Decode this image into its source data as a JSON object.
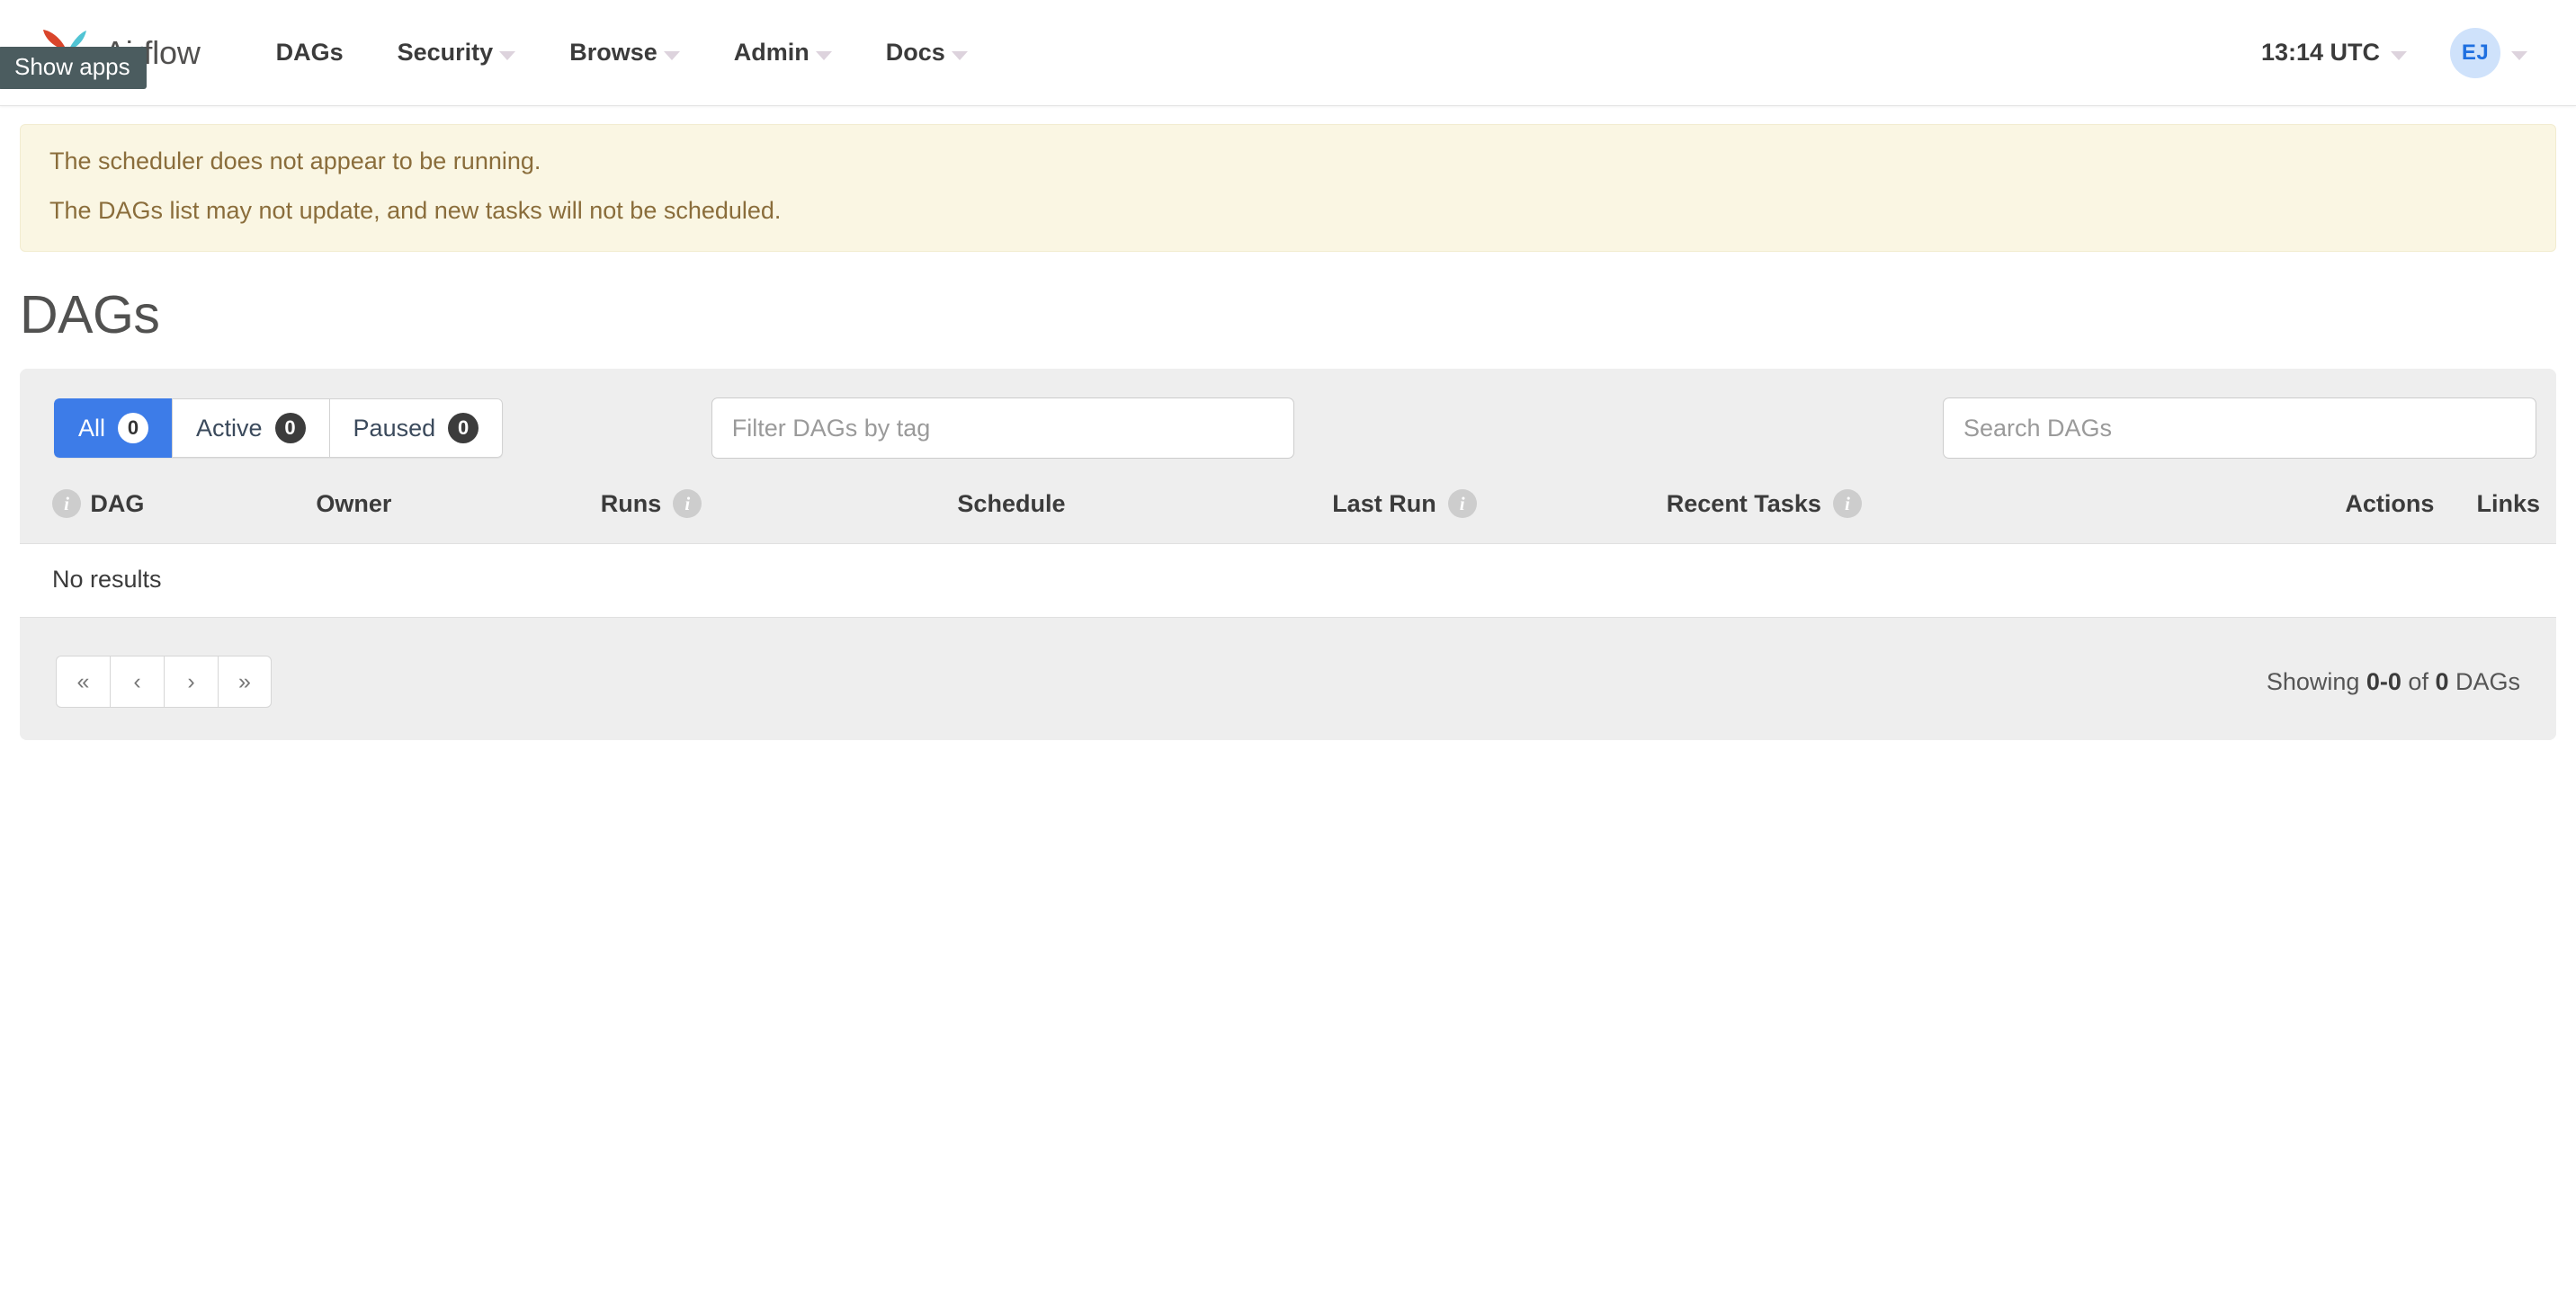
{
  "navbar": {
    "brand_name": "Airflow",
    "logo_icon": "airflow-pinwheel-logo",
    "tooltip": "Show apps",
    "items": [
      {
        "label": "DAGs",
        "has_caret": false
      },
      {
        "label": "Security",
        "has_caret": true
      },
      {
        "label": "Browse",
        "has_caret": true
      },
      {
        "label": "Admin",
        "has_caret": true
      },
      {
        "label": "Docs",
        "has_caret": true
      }
    ],
    "time": "13:14 UTC",
    "avatar_initials": "EJ"
  },
  "alert": {
    "line1": "The scheduler does not appear to be running.",
    "line2": "The DAGs list may not update, and new tasks will not be scheduled."
  },
  "page": {
    "title": "DAGs"
  },
  "toolbar": {
    "tabs": [
      {
        "label": "All",
        "count": "0",
        "active": true
      },
      {
        "label": "Active",
        "count": "0",
        "active": false
      },
      {
        "label": "Paused",
        "count": "0",
        "active": false
      }
    ],
    "filter_tag": {
      "value": "",
      "placeholder": "Filter DAGs by tag"
    },
    "search_dags": {
      "value": "",
      "placeholder": "Search DAGs"
    }
  },
  "table": {
    "columns": [
      {
        "label": "",
        "info": true,
        "align": "left"
      },
      {
        "label": "DAG",
        "info": false,
        "align": "left"
      },
      {
        "label": "Owner",
        "info": false,
        "align": "left"
      },
      {
        "label": "Runs",
        "info": true,
        "align": "left"
      },
      {
        "label": "Schedule",
        "info": false,
        "align": "left"
      },
      {
        "label": "Last Run",
        "info": true,
        "align": "left"
      },
      {
        "label": "Recent Tasks",
        "info": true,
        "align": "left"
      },
      {
        "label": "Actions",
        "info": false,
        "align": "right"
      },
      {
        "label": "Links",
        "info": false,
        "align": "right"
      }
    ],
    "empty_text": "No results",
    "rows": []
  },
  "pagination": {
    "buttons": [
      {
        "label": "«",
        "name": "first"
      },
      {
        "label": "‹",
        "name": "prev"
      },
      {
        "label": "›",
        "name": "next"
      },
      {
        "label": "»",
        "name": "last"
      }
    ],
    "showing_prefix": "Showing ",
    "showing_range": "0-0",
    "showing_mid": " of ",
    "showing_total": "0",
    "showing_suffix": " DAGs"
  },
  "colors": {
    "accent_blue": "#3d7ce8",
    "alert_bg": "#faf6e3",
    "alert_text": "#8a6d3b",
    "panel_bg": "#eeeeee",
    "avatar_bg": "#cfe2fb",
    "avatar_text": "#1e6fe0"
  }
}
